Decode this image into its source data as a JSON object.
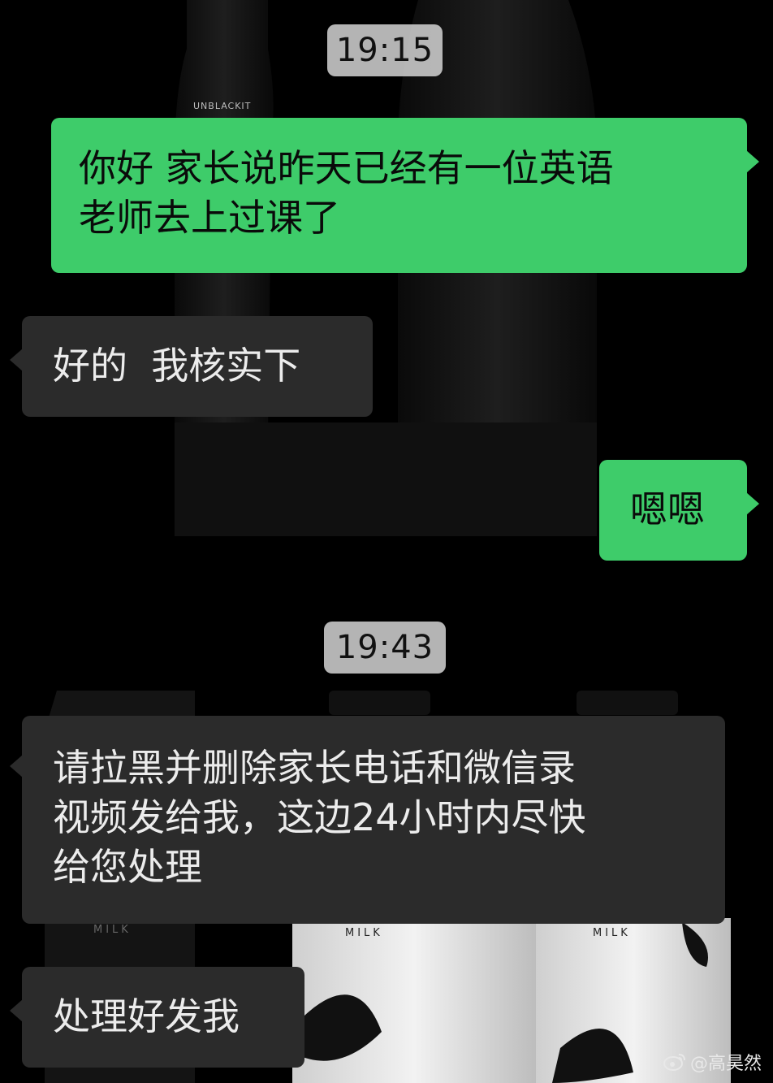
{
  "chat": {
    "timestamps": [
      "19:15",
      "19:43"
    ],
    "messages": [
      {
        "id": "m1",
        "side": "sent",
        "text": "你好 家长说昨天已经有一位英语\n老师去上过课了"
      },
      {
        "id": "m2",
        "side": "received",
        "text": "好的  我核实下"
      },
      {
        "id": "m3",
        "side": "sent",
        "text": "嗯嗯"
      },
      {
        "id": "m4",
        "side": "received",
        "text": "请拉黑并删除家长电话和微信录\n视频发给我，这边24小时内尽快\n给您处理"
      },
      {
        "id": "m5",
        "side": "received",
        "text": "处理好发我"
      }
    ]
  },
  "background_bottle_labels": {
    "top_brand": "UNBLACKIT",
    "bottle_text": "MILK"
  },
  "watermark": {
    "text": "@高昊然",
    "icon": "weibo-icon"
  },
  "colors": {
    "sent_bubble": "#3ecc6a",
    "received_bubble": "#2b2b2b",
    "timestamp_bg": "#d6d6d6",
    "background": "#000000"
  }
}
